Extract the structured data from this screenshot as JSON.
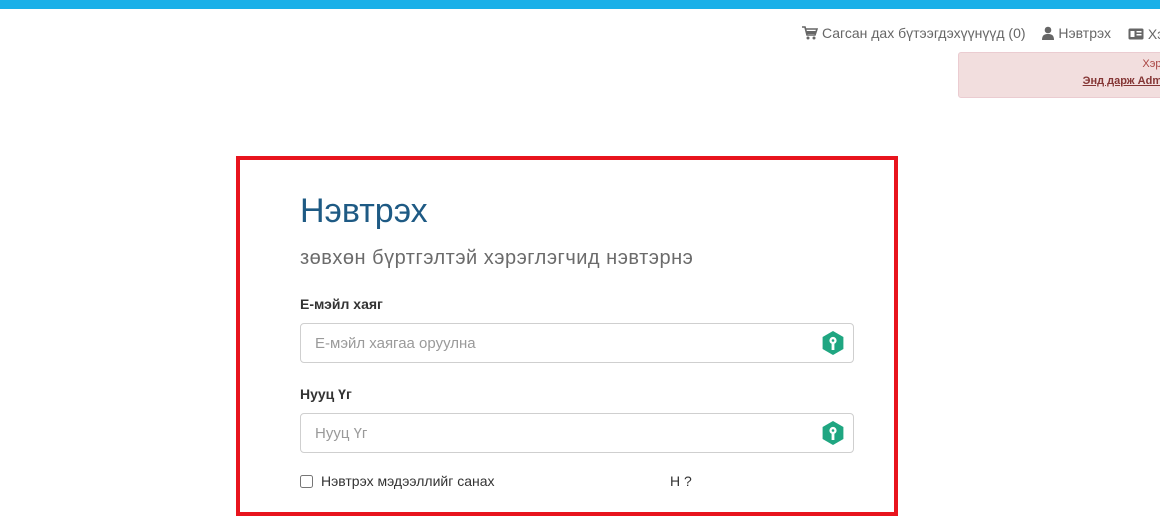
{
  "header": {
    "cart_label": "Сагсан дах бүтээгдэхүүнүүд (0)",
    "login_label": "Нэвтрэх",
    "register_label": "Хэ"
  },
  "alert": {
    "line1": "Хэрэв та",
    "line2": "Энд дарж Admin хэ"
  },
  "login": {
    "title": "Нэвтрэх",
    "subtitle": "зөвхөн бүртгэлтэй хэрэглэгчид нэвтэрнэ",
    "email_label": "Е-мэйл хаяг",
    "email_placeholder": "Е-мэйл хаягаа оруулна",
    "password_label": "Нууц Үг",
    "password_placeholder": "Нууц Үг",
    "remember_label": "Нэвтрэх мэдээллийг санах",
    "forgot_label": "Н                             ?"
  },
  "colors": {
    "topbar": "#1ab0e8",
    "title": "#1e5a84",
    "highlight_border": "#e8141d",
    "key_icon": "#1fa681"
  }
}
